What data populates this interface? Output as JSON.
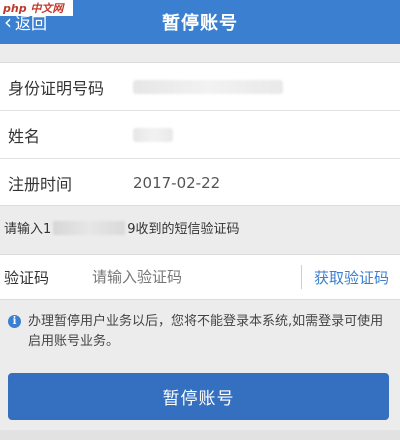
{
  "watermark": "php 中文网",
  "header": {
    "back_label": "返回",
    "title": "暂停账号",
    "background": "#3b7fd0"
  },
  "info": {
    "id_label": "身份证明号码",
    "name_label": "姓名",
    "reg_label": "注册时间",
    "reg_value": "2017-02-22"
  },
  "sms_tip": {
    "prefix": "请输入1",
    "suffix": "9收到的短信验证码"
  },
  "code": {
    "label": "验证码",
    "placeholder": "请输入验证码",
    "get_code": "获取验证码"
  },
  "notice": {
    "icon": "info-icon",
    "text": "办理暂停用户业务以后，您将不能登录本系统,如需登录可使用启用账号业务。"
  },
  "action": {
    "label": "暂停账号",
    "color": "#3570c0"
  }
}
